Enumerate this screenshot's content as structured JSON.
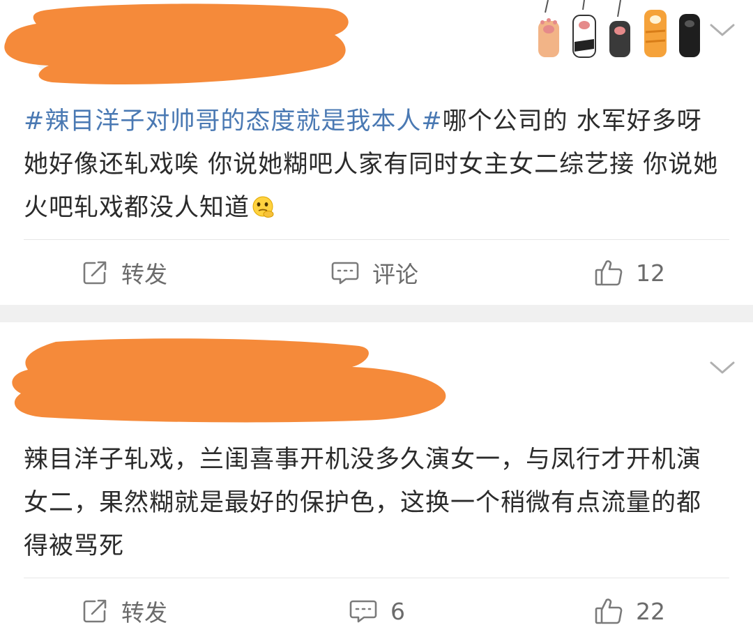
{
  "posts": [
    {
      "text_parts": [
        "#辣目洋子对帅哥的态度就是我本人#",
        "哪个公司的 水军好多呀  她好像还轧戏唉 你说她糊吧人家有同时女主女二综艺接 你说她火吧轧戏都没人知道"
      ],
      "emoji_icon": "thinking-emoji",
      "actions": {
        "repost_label": "转发",
        "comment_label": "评论",
        "like_count": "12"
      }
    },
    {
      "text": "辣目洋子轧戏，兰闺喜事开机没多久演女一，与凤行才开机演女二，果然糊就是最好的保护色，这换一个稍微有点流量的都得被骂死",
      "actions": {
        "repost_label": "转发",
        "comment_count": "6",
        "like_count": "22"
      }
    }
  ],
  "colors": {
    "hashtag": "#4a79b3",
    "redaction": "#f58a3a",
    "action_text": "#6b6b6b",
    "divider": "#f0f0f0"
  },
  "icons": {
    "repost": "edit-square-icon",
    "comment": "comment-bubble-icon",
    "like": "thumbs-up-icon",
    "menu": "chevron-down-icon",
    "decoration": "cat-paws-icon"
  }
}
